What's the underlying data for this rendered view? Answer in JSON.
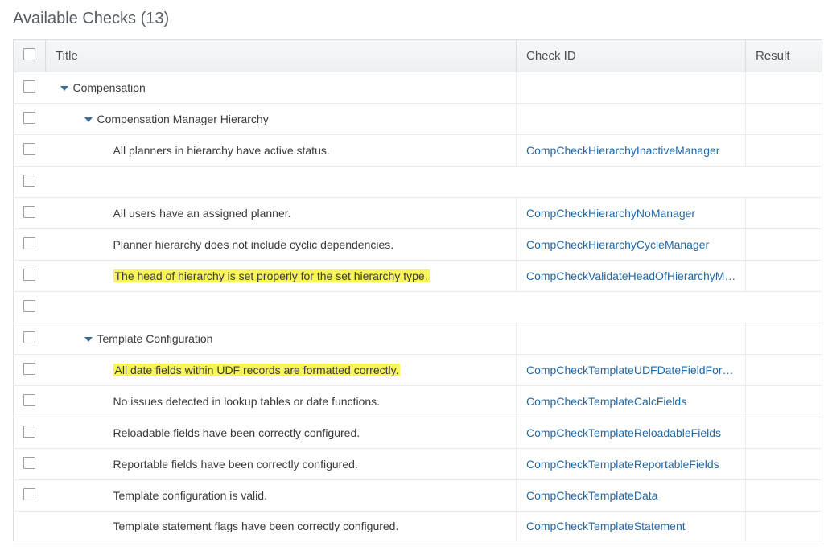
{
  "page_title": "Available Checks (13)",
  "columns": {
    "title": "Title",
    "check_id": "Check ID",
    "result": "Result"
  },
  "tree": [
    {
      "kind": "group",
      "indent": 0,
      "label": "Compensation",
      "has_checkbox": true
    },
    {
      "kind": "group",
      "indent": 1,
      "label": "Compensation Manager Hierarchy",
      "has_checkbox": true
    },
    {
      "kind": "item",
      "indent": 2,
      "label": "All planners in hierarchy have active status.",
      "check_id": "CompCheckHierarchyInactiveManager",
      "highlight": false,
      "has_checkbox": true
    },
    {
      "kind": "spacer",
      "has_checkbox": true
    },
    {
      "kind": "item",
      "indent": 2,
      "label": "All users have an assigned planner.",
      "check_id": "CompCheckHierarchyNoManager",
      "highlight": false,
      "has_checkbox": true
    },
    {
      "kind": "item",
      "indent": 2,
      "label": "Planner hierarchy does not include cyclic dependencies.",
      "check_id": "CompCheckHierarchyCycleManager",
      "highlight": false,
      "has_checkbox": true
    },
    {
      "kind": "item",
      "indent": 2,
      "label": "The head of hierarchy is set properly for the set hierarchy type.",
      "check_id": "CompCheckValidateHeadOfHierarchyM…",
      "highlight": true,
      "has_checkbox": true
    },
    {
      "kind": "spacer",
      "has_checkbox": true
    },
    {
      "kind": "group",
      "indent": 1,
      "label": "Template Configuration",
      "has_checkbox": true
    },
    {
      "kind": "item",
      "indent": 2,
      "label": "All date fields within UDF records are formatted correctly.",
      "check_id": "CompCheckTemplateUDFDateFieldFor…",
      "highlight": true,
      "has_checkbox": true
    },
    {
      "kind": "item",
      "indent": 2,
      "label": "No issues detected in lookup tables or date functions.",
      "check_id": "CompCheckTemplateCalcFields",
      "highlight": false,
      "has_checkbox": true
    },
    {
      "kind": "item",
      "indent": 2,
      "label": "Reloadable fields have been correctly configured.",
      "check_id": "CompCheckTemplateReloadableFields",
      "highlight": false,
      "has_checkbox": true
    },
    {
      "kind": "item",
      "indent": 2,
      "label": "Reportable fields have been correctly configured.",
      "check_id": "CompCheckTemplateReportableFields",
      "highlight": false,
      "has_checkbox": true
    },
    {
      "kind": "item",
      "indent": 2,
      "label": "Template configuration is valid.",
      "check_id": "CompCheckTemplateData",
      "highlight": false,
      "has_checkbox": true
    },
    {
      "kind": "item",
      "indent": 2,
      "label": "Template statement flags have been correctly configured.",
      "check_id": "CompCheckTemplateStatement",
      "highlight": false,
      "has_checkbox": false
    }
  ]
}
